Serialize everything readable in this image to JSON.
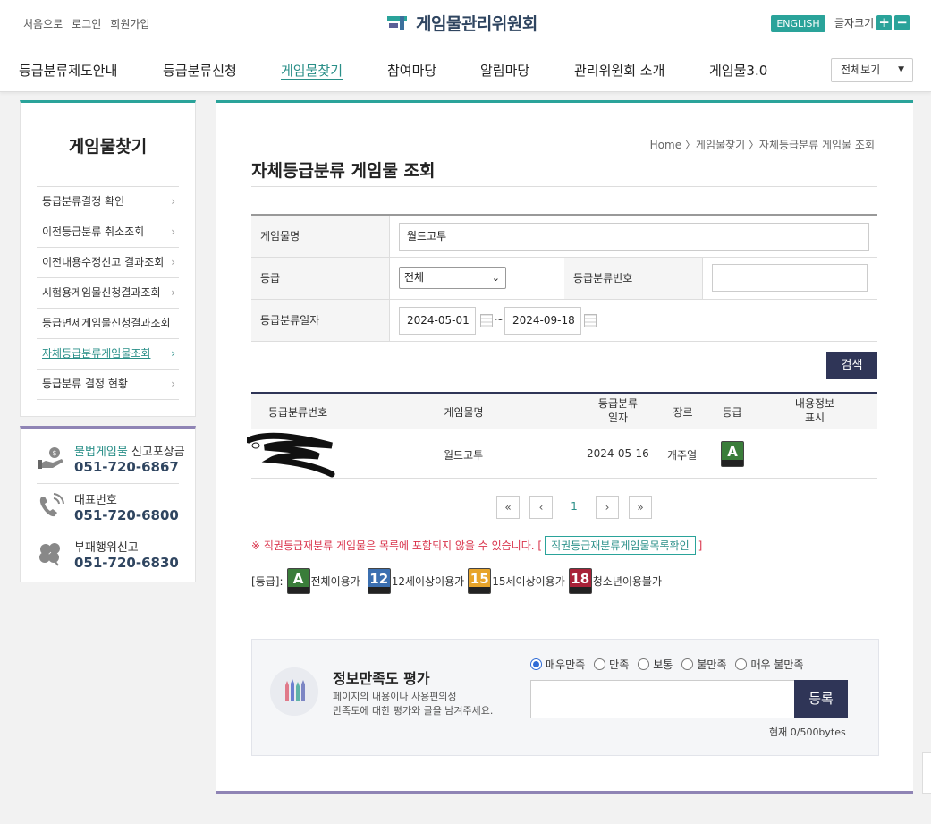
{
  "header": {
    "util_links": [
      "처음으로",
      "로그인",
      "회원가입"
    ],
    "logo_text": "게임물관리위원회",
    "english_label": "ENGLISH",
    "font_size_label": "글자크기",
    "font_plus": "+",
    "font_minus": "−"
  },
  "gnb": {
    "items": [
      "등급분류제도안내",
      "등급분류신청",
      "게임물찾기",
      "참여마당",
      "알림마당",
      "관리위원회 소개",
      "게임물3.0"
    ],
    "active_index": 2,
    "view_all": "전체보기"
  },
  "sidebar": {
    "title": "게임물찾기",
    "items": [
      "등급분류결정 확인",
      "이전등급분류 취소조회",
      "이전내용수정신고 결과조회",
      "시험용게임물신청결과조회",
      "등급면제게임물신청결과조회",
      "자체등급분류게임물조회",
      "등급분류 결정 현황"
    ],
    "active_index": 5,
    "chevron": "›",
    "contacts": [
      {
        "label_hl": "불법게임물",
        "label": " 신고포상금",
        "number": "051-720-6867",
        "icon": "money-hand-icon"
      },
      {
        "label_hl": "",
        "label": "대표번호",
        "number": "051-720-6800",
        "icon": "phone-icon"
      },
      {
        "label_hl": "",
        "label": "부패행위신고",
        "number": "051-720-6830",
        "icon": "clover-icon"
      }
    ]
  },
  "main": {
    "breadcrumb": "Home 〉게임물찾기 〉자체등급분류 게임물 조회",
    "title": "자체등급분류 게임물 조회",
    "form": {
      "name_label": "게임물명",
      "name_value": "월드고투",
      "grade_label": "등급",
      "grade_value": "전체",
      "class_no_label": "등급분류번호",
      "class_no_value": "",
      "date_label": "등급분류일자",
      "date_from": "2024-05-01",
      "date_to": "2024-09-18",
      "tilde": "~"
    },
    "search_label": "검색",
    "table": {
      "headers": [
        "등급분류번호",
        "게임물명",
        "등급분류\n일자",
        "장르",
        "등급",
        "내용정보\n표시"
      ],
      "rows": [
        {
          "class_no": "",
          "name": "월드고투",
          "date": "2024-05-16",
          "genre": "캐주얼",
          "grade": "전체이용가"
        }
      ]
    },
    "pagination": {
      "first": "«",
      "prev": "‹",
      "current": "1",
      "next": "›",
      "last": "»"
    },
    "notice": {
      "text": "※ 직권등급재분류 게임물은 목록에 포함되지 않을 수 있습니다. [",
      "link": "직권등급재분류게임물목록확인",
      "close": "]"
    },
    "legend": {
      "prefix": "[등급]:",
      "items": [
        {
          "mark": "A",
          "label": "전체이용가",
          "color": "#3a7d3a"
        },
        {
          "mark": "12",
          "label": "12세이상이용가",
          "color": "#3b6fb0"
        },
        {
          "mark": "15",
          "label": "15세이상이용가",
          "color": "#e7a42b"
        },
        {
          "mark": "18",
          "label": "청소년이용불가",
          "color": "#a82238"
        }
      ]
    },
    "survey": {
      "title": "정보만족도 평가",
      "desc_line1": "페이지의 내용이나 사용편의성",
      "desc_line2": "만족도에 대한 평가와 글을 남겨주세요.",
      "options": [
        "매우만족",
        "만족",
        "보통",
        "불만족",
        "매우 불만족"
      ],
      "selected_index": 0,
      "submit": "등록",
      "counter": "현재 0/500bytes"
    }
  },
  "colors": {
    "teal": "#2aa39a",
    "navy": "#2f3557",
    "purple": "#8f84b5",
    "notice_red": "#d9334b"
  }
}
